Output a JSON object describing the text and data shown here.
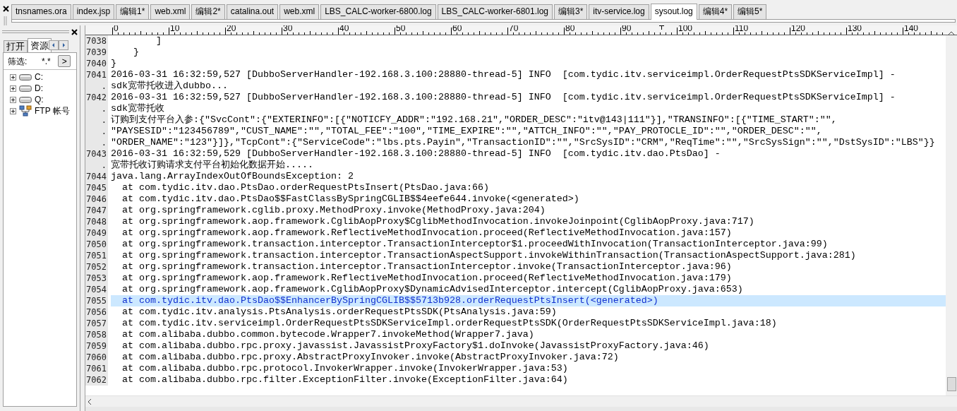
{
  "file_tabs": [
    {
      "label": "tnsnames.ora",
      "selected": false
    },
    {
      "label": "index.jsp",
      "selected": false
    },
    {
      "label": "编辑1*",
      "selected": false
    },
    {
      "label": "web.xml",
      "selected": false
    },
    {
      "label": "编辑2*",
      "selected": false
    },
    {
      "label": "catalina.out",
      "selected": false
    },
    {
      "label": "web.xml",
      "selected": false
    },
    {
      "label": "LBS_CALC-worker-6800.log",
      "selected": false
    },
    {
      "label": "LBS_CALC-worker-6801.log",
      "selected": false
    },
    {
      "label": "编辑3*",
      "selected": false
    },
    {
      "label": "itv-service.log",
      "selected": false
    },
    {
      "label": "sysout.log",
      "selected": true
    },
    {
      "label": "编辑4*",
      "selected": false
    },
    {
      "label": "编辑5*",
      "selected": false
    }
  ],
  "side_panel": {
    "tabs": [
      {
        "label": "打开",
        "selected": false
      },
      {
        "label": "资源",
        "selected": true
      }
    ],
    "filter": {
      "label": "筛选:",
      "value": "*.*",
      "go": ">"
    },
    "tree": [
      {
        "label": "C:",
        "kind": "drive",
        "expanded": false
      },
      {
        "label": "D:",
        "kind": "drive",
        "expanded": false
      },
      {
        "label": "Q:",
        "kind": "drive",
        "expanded": false
      },
      {
        "label": "FTP 帐号",
        "kind": "ftp",
        "expanded": false
      }
    ]
  },
  "editor": {
    "ruler": [
      "0",
      "10",
      "20",
      "30",
      "40",
      "50",
      "60",
      "70",
      "80",
      "90",
      "100",
      "110",
      "120",
      "130",
      "140"
    ],
    "rows": [
      {
        "selected": false,
        "lines": [
          {
            "gutter": "7038",
            "text": "        ]"
          }
        ]
      },
      {
        "selected": false,
        "lines": [
          {
            "gutter": "7039",
            "text": "    }"
          }
        ]
      },
      {
        "selected": false,
        "lines": [
          {
            "gutter": "7040",
            "text": "}"
          }
        ]
      },
      {
        "selected": false,
        "lines": [
          {
            "gutter": "7041",
            "text": "2016-03-31 16:32:59,527 [DubboServerHandler-192.168.3.100:28880-thread-5] INFO  [com.tydic.itv.serviceimpl.OrderRequestPtsSDKServiceImpl] -"
          },
          {
            "gutter": ".",
            "text": "sdk宽带托收进入dubbo..."
          }
        ]
      },
      {
        "selected": false,
        "lines": [
          {
            "gutter": "7042",
            "text": "2016-03-31 16:32:59,527 [DubboServerHandler-192.168.3.100:28880-thread-5] INFO  [com.tydic.itv.serviceimpl.OrderRequestPtsSDKServiceImpl] -"
          },
          {
            "gutter": ".",
            "text": "sdk宽带托收"
          },
          {
            "gutter": ".",
            "text": "订购到支付平台入参:{\"SvcCont\":{\"EXTERINFO\":[{\"NOTICFY_ADDR\":\"192.168.21\",\"ORDER_DESC\":\"itv@143|111\"}],\"TRANSINFO\":[{\"TIME_START\":\"\","
          },
          {
            "gutter": ".",
            "text": "\"PAYSESID\":\"123456789\",\"CUST_NAME\":\"\",\"TOTAL_FEE\":\"100\",\"TIME_EXPIRE\":\"\",\"ATTCH_INFO\":\"\",\"PAY_PROTOCLE_ID\":\"\",\"ORDER_DESC\":\"\","
          },
          {
            "gutter": ".",
            "text": "\"ORDER_NAME\":\"123\"}]},\"TcpCont\":{\"ServiceCode\":\"lbs.pts.Payin\",\"TransactionID\":\"\",\"SrcSysID\":\"CRM\",\"ReqTime\":\"\",\"SrcSysSign\":\"\",\"DstSysID\":\"LBS\"}}"
          }
        ]
      },
      {
        "selected": false,
        "lines": [
          {
            "gutter": "7043",
            "text": "2016-03-31 16:32:59,529 [DubboServerHandler-192.168.3.100:28880-thread-5] INFO  [com.tydic.itv.dao.PtsDao] -"
          },
          {
            "gutter": ".",
            "text": "宽带托收订购请求支付平台初始化数据开始....."
          }
        ]
      },
      {
        "selected": false,
        "lines": [
          {
            "gutter": "7044",
            "text": "java.lang.ArrayIndexOutOfBoundsException: 2"
          }
        ]
      },
      {
        "selected": false,
        "lines": [
          {
            "gutter": "7045",
            "text": "  at com.tydic.itv.dao.PtsDao.orderRequestPtsInsert(PtsDao.java:66)"
          }
        ]
      },
      {
        "selected": false,
        "lines": [
          {
            "gutter": "7046",
            "text": "  at com.tydic.itv.dao.PtsDao$$FastClassBySpringCGLIB$$4eefe644.invoke(<generated>)"
          }
        ]
      },
      {
        "selected": false,
        "lines": [
          {
            "gutter": "7047",
            "text": "  at org.springframework.cglib.proxy.MethodProxy.invoke(MethodProxy.java:204)"
          }
        ]
      },
      {
        "selected": false,
        "lines": [
          {
            "gutter": "7048",
            "text": "  at org.springframework.aop.framework.CglibAopProxy$CglibMethodInvocation.invokeJoinpoint(CglibAopProxy.java:717)"
          }
        ]
      },
      {
        "selected": false,
        "lines": [
          {
            "gutter": "7049",
            "text": "  at org.springframework.aop.framework.ReflectiveMethodInvocation.proceed(ReflectiveMethodInvocation.java:157)"
          }
        ]
      },
      {
        "selected": false,
        "lines": [
          {
            "gutter": "7050",
            "text": "  at org.springframework.transaction.interceptor.TransactionInterceptor$1.proceedWithInvocation(TransactionInterceptor.java:99)"
          }
        ]
      },
      {
        "selected": false,
        "lines": [
          {
            "gutter": "7051",
            "text": "  at org.springframework.transaction.interceptor.TransactionAspectSupport.invokeWithinTransaction(TransactionAspectSupport.java:281)"
          }
        ]
      },
      {
        "selected": false,
        "lines": [
          {
            "gutter": "7052",
            "text": "  at org.springframework.transaction.interceptor.TransactionInterceptor.invoke(TransactionInterceptor.java:96)"
          }
        ]
      },
      {
        "selected": false,
        "lines": [
          {
            "gutter": "7053",
            "text": "  at org.springframework.aop.framework.ReflectiveMethodInvocation.proceed(ReflectiveMethodInvocation.java:179)"
          }
        ]
      },
      {
        "selected": false,
        "lines": [
          {
            "gutter": "7054",
            "text": "  at org.springframework.aop.framework.CglibAopProxy$DynamicAdvisedInterceptor.intercept(CglibAopProxy.java:653)"
          }
        ]
      },
      {
        "selected": true,
        "lines": [
          {
            "gutter": "7055",
            "text": "  at com.tydic.itv.dao.PtsDao$$EnhancerBySpringCGLIB$$5713b928.orderRequestPtsInsert(<generated>)"
          }
        ]
      },
      {
        "selected": false,
        "lines": [
          {
            "gutter": "7056",
            "text": "  at com.tydic.itv.analysis.PtsAnalysis.orderRequestPtsSDK(PtsAnalysis.java:59)"
          }
        ]
      },
      {
        "selected": false,
        "lines": [
          {
            "gutter": "7057",
            "text": "  at com.tydic.itv.serviceimpl.OrderRequestPtsSDKServiceImpl.orderRequestPtsSDK(OrderRequestPtsSDKServiceImpl.java:18)"
          }
        ]
      },
      {
        "selected": false,
        "lines": [
          {
            "gutter": "7058",
            "text": "  at com.alibaba.dubbo.common.bytecode.Wrapper7.invokeMethod(Wrapper7.java)"
          }
        ]
      },
      {
        "selected": false,
        "lines": [
          {
            "gutter": "7059",
            "text": "  at com.alibaba.dubbo.rpc.proxy.javassist.JavassistProxyFactory$1.doInvoke(JavassistProxyFactory.java:46)"
          }
        ]
      },
      {
        "selected": false,
        "lines": [
          {
            "gutter": "7060",
            "text": "  at com.alibaba.dubbo.rpc.proxy.AbstractProxyInvoker.invoke(AbstractProxyInvoker.java:72)"
          }
        ]
      },
      {
        "selected": false,
        "lines": [
          {
            "gutter": "7061",
            "text": "  at com.alibaba.dubbo.rpc.protocol.InvokerWrapper.invoke(InvokerWrapper.java:53)"
          }
        ]
      },
      {
        "selected": false,
        "lines": [
          {
            "gutter": "7062",
            "text": "  at com.alibaba.dubbo.rpc.filter.ExceptionFilter.invoke(ExceptionFilter.java:64)"
          }
        ]
      }
    ]
  }
}
